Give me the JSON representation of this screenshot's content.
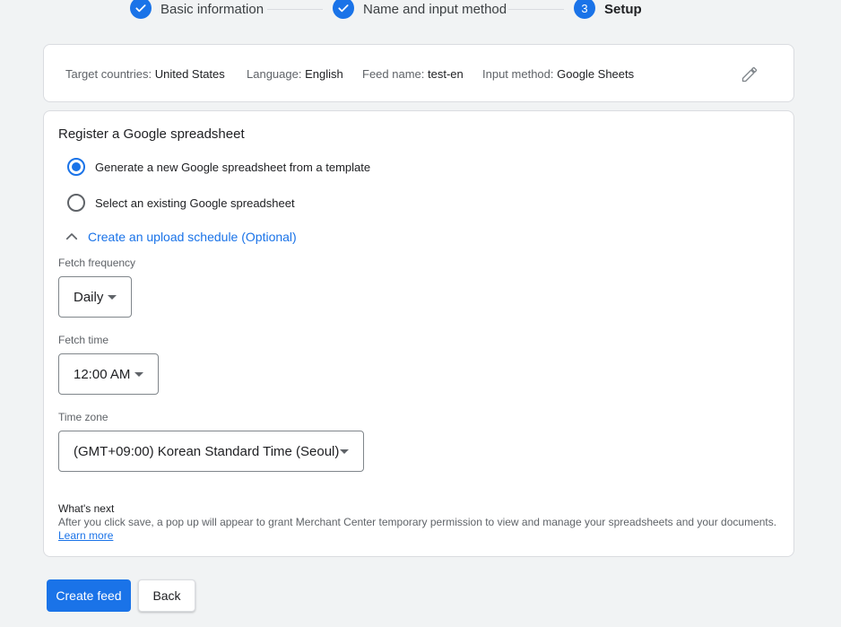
{
  "stepper": {
    "steps": [
      {
        "label": "Basic information",
        "state": "done"
      },
      {
        "label": "Name and input method",
        "state": "done"
      },
      {
        "label": "Setup",
        "state": "active",
        "number": "3"
      }
    ]
  },
  "summary": {
    "target_countries_label": "Target countries:",
    "target_countries_value": "United States",
    "language_label": "Language:",
    "language_value": "English",
    "feed_name_label": "Feed name:",
    "feed_name_value": "test-en",
    "input_method_label": "Input method:",
    "input_method_value": "Google Sheets",
    "edit_icon": "pencil-icon"
  },
  "register": {
    "title": "Register a Google spreadsheet",
    "options": [
      {
        "label": "Generate a new Google spreadsheet from a template",
        "selected": true
      },
      {
        "label": "Select an existing Google spreadsheet",
        "selected": false
      }
    ],
    "schedule_toggle": "Create an upload schedule (Optional)",
    "schedule_icon": "chevron-up-icon"
  },
  "schedule": {
    "fetch_frequency_label": "Fetch frequency",
    "fetch_frequency_value": "Daily",
    "fetch_time_label": "Fetch time",
    "fetch_time_value": "12:00 AM",
    "time_zone_label": "Time zone",
    "time_zone_value": "(GMT+09:00) Korean Standard Time (Seoul)"
  },
  "whats_next": {
    "title": "What's next",
    "text": "After you click save, a pop up will appear to grant Merchant Center temporary permission to view and manage your spreadsheets and your documents.",
    "link": "Learn more"
  },
  "actions": {
    "create_label": "Create feed",
    "back_label": "Back"
  },
  "colors": {
    "accent": "#1a73e8",
    "background": "#f1f3f4"
  }
}
